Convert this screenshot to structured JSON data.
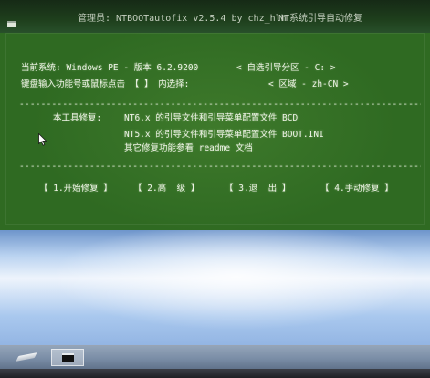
{
  "window": {
    "title": "管理员: NTBOOTautofix v2.5.4 by chz_hlh",
    "subtitle": "NT系统引导自动修复"
  },
  "console": {
    "system_info": "当前系统: Windows PE - 版本 6.2.9200",
    "partition": "< 自选引导分区 - C: >",
    "prompt": "键盘输入功能号或鼠标点击 【 】 内选择:",
    "region": "< 区域 - zh-CN >",
    "separator": "--------------------------------------------------------------------------------",
    "repair_label": "本工具修复:",
    "repair_items": [
      "NT6.x 的引导文件和引导菜单配置文件 BCD",
      "NT5.x 的引导文件和引导菜单配置文件 BOOT.INI",
      "其它修复功能参看 readme 文档"
    ],
    "options": [
      "【 1.开始修复 】",
      "【 2.高  级 】",
      "【 3.退  出 】",
      "【 4.手动修复 】"
    ]
  },
  "icons": {
    "window": "console-app-icon",
    "cursor": "mouse-pointer-icon",
    "taskbar": [
      "drive-icon",
      "console-icon"
    ]
  },
  "colors": {
    "console_bg": "#2f6a22",
    "title_bar_bg": "#1e3f1c",
    "console_text": "#eef3e6",
    "desktop_bg": "#a9c8ee",
    "taskbar_bg": "#7a8da6"
  }
}
